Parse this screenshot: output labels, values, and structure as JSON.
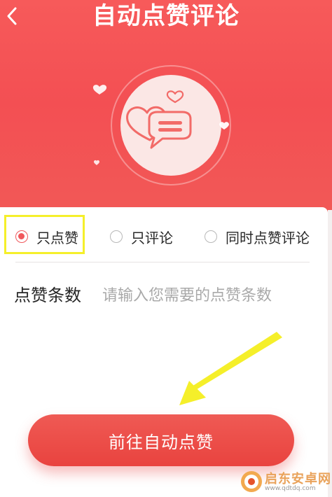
{
  "header": {
    "title": "自动点赞评论",
    "back_icon": "chevron-left-icon",
    "hero_icon": "chat-hearts-icon"
  },
  "options": {
    "like_only": "只点赞",
    "comment_only": "只评论",
    "like_and_comment": "同时点赞评论",
    "selected": "只点赞"
  },
  "form": {
    "count_label": "点赞条数",
    "count_placeholder": "请输入您需要的点赞条数",
    "count_value": ""
  },
  "action": {
    "go_label": "前往自动点赞"
  },
  "watermark": {
    "name": "启东安卓网",
    "url": "www.qdtdq.com"
  },
  "colors": {
    "brand_red": "#f25a57",
    "accent_red": "#f0585c",
    "highlight_yellow": "#f5ef2a"
  }
}
